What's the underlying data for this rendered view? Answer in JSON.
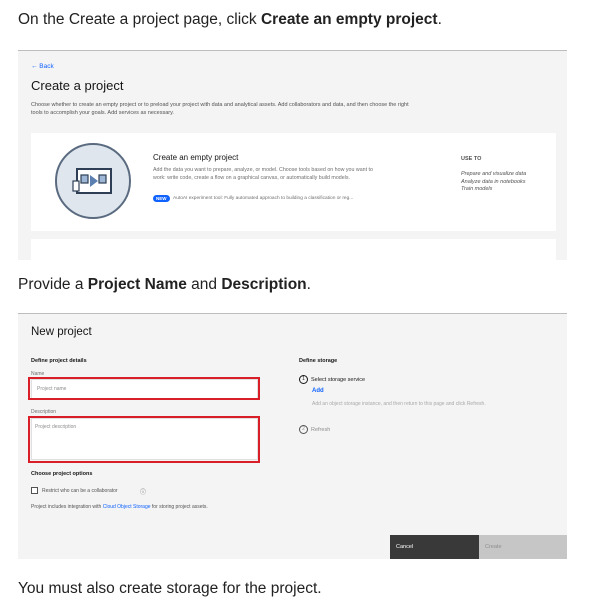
{
  "instructions": {
    "step1_prefix": "On the Create a project page, click ",
    "step1_bold": "Create an empty project",
    "step1_suffix": ".",
    "step2_prefix": "Provide a ",
    "step2_bold1": "Project Name",
    "step2_mid": " and ",
    "step2_bold2": "Description",
    "step2_suffix": ".",
    "step3": "You must also create storage for the project."
  },
  "create_project_screen": {
    "back_label": "← Back",
    "title": "Create a project",
    "description": "Choose whether to create an empty project or to preload your project with data and analytical assets. Add collaborators and data, and then choose the right tools to accomplish your goals. Add services as necessary.",
    "card": {
      "title": "Create an empty project",
      "description": "Add the data you want to prepare, analyze, or model. Choose tools based on how you want to work: write code, create a flow on a graphical canvas, or automatically build models.",
      "badge": "NEW",
      "badge_text": "AutoAI experiment tool: Fully automated approach to building a classification or reg...",
      "use_to_label": "USE TO",
      "use_to_items": [
        "Prepare and visualize data",
        "Analyze data in notebooks",
        "Train models"
      ]
    }
  },
  "new_project_screen": {
    "title": "New project",
    "define_details_label": "Define project details",
    "name_label": "Name",
    "name_placeholder": "Project name",
    "description_label": "Description",
    "description_placeholder": "Project description",
    "project_options_label": "Choose project options",
    "restrict_label": "Restrict who can be a collaborator",
    "integration_prefix": "Project includes integration with ",
    "integration_link": "Cloud Object Storage",
    "integration_suffix": " for storing project assets.",
    "define_storage_label": "Define storage",
    "storage_step1_num": "1",
    "storage_step1": "Select storage service",
    "add_link": "Add",
    "storage_help": "Add an object storage instance, and then return to this page and click Refresh.",
    "storage_step2_num": "2",
    "storage_step2": "Refresh",
    "cancel_label": "Cancel",
    "create_label": "Create",
    "highlight_color": "#da1e28"
  }
}
